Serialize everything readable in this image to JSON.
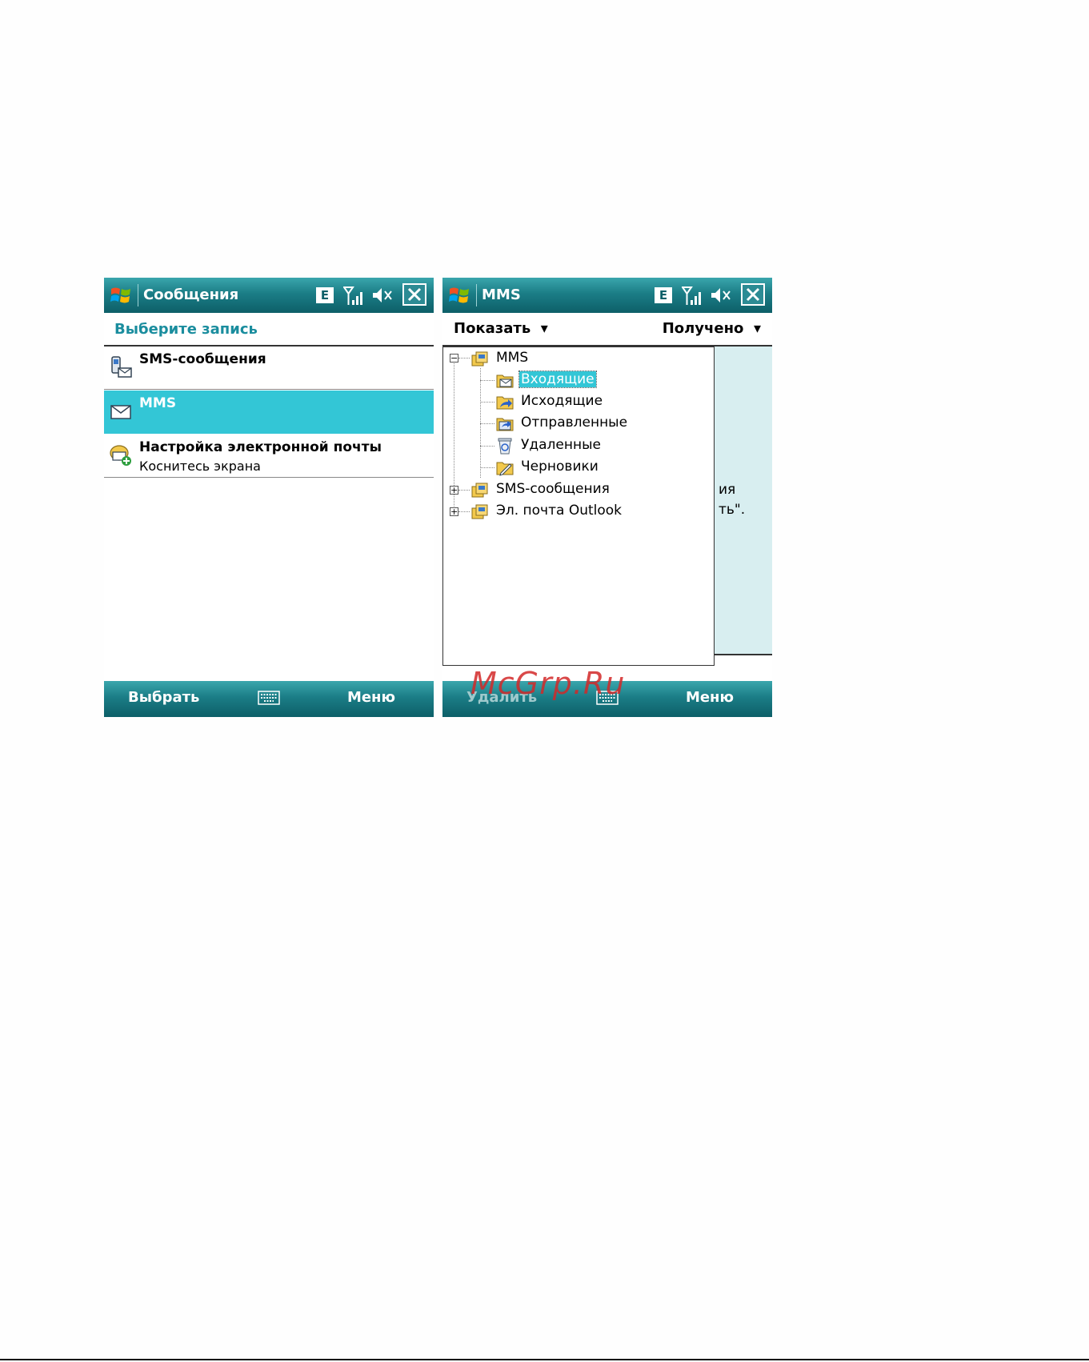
{
  "left_screen": {
    "title": "Сообщения",
    "status_e": "E",
    "header": "Выберите запись",
    "items": [
      {
        "primary": "SMS-сообщения",
        "secondary": "",
        "icon": "sms-phone-icon",
        "selected": false
      },
      {
        "primary": "MMS",
        "secondary": "",
        "icon": "envelope-icon",
        "selected": true
      },
      {
        "primary": "Настройка электронной почты",
        "secondary": "Коснитесь экрана",
        "icon": "email-setup-icon",
        "selected": false
      }
    ],
    "softkey_left": "Выбрать",
    "softkey_right": "Меню"
  },
  "right_screen": {
    "title": "MMS",
    "status_e": "E",
    "filter_left": "Показать",
    "filter_right": "Получено",
    "background_text": [
      "ия",
      "ть\"."
    ],
    "tree": {
      "root": "MMS",
      "children": [
        "Входящие",
        "Исходящие",
        "Отправленные",
        "Удаленные",
        "Черновики"
      ],
      "selected": "Входящие",
      "collapsed": [
        "SMS-сообщения",
        "Эл. почта Outlook"
      ]
    },
    "softkey_left": "Удалить",
    "softkey_right": "Меню"
  },
  "watermark": "McGrp.Ru",
  "colors": {
    "titlebar": "#1b7d86",
    "selection": "#33c6d6",
    "header_text": "#1a8d9e"
  }
}
